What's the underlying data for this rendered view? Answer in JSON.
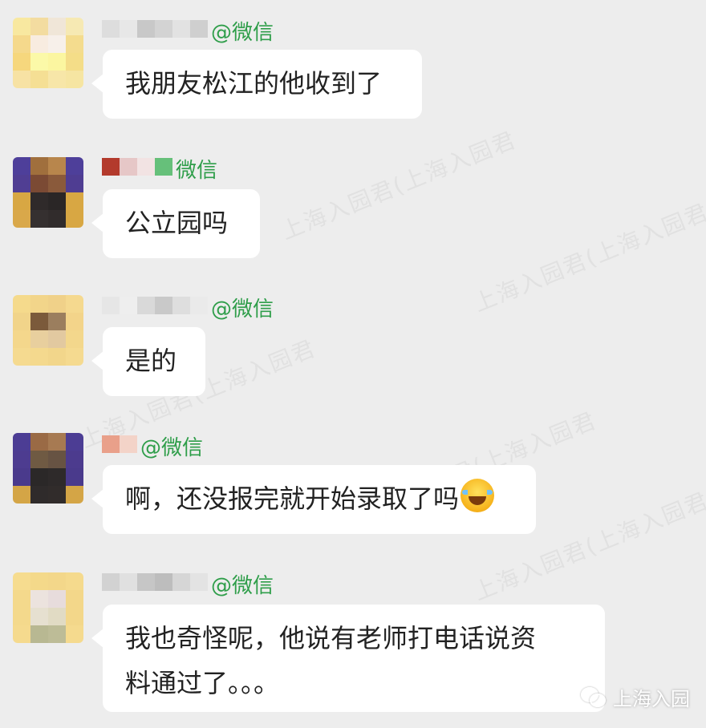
{
  "watermark": {
    "text": "上海入园君(上海入园君"
  },
  "messages": [
    {
      "sender_suffix": "@微信",
      "text": "我朋友松江的他收到了",
      "avatar_colors": [
        "#f8e8a0",
        "#f3dca0",
        "#f0e6d8",
        "#f6e9b3",
        "#f5d98c",
        "#f8ece0",
        "#f7f0ea",
        "#f4dc8e",
        "#f6d77d",
        "#fbf9a8",
        "#fbf6a0",
        "#f4dd88",
        "#f7e2a4",
        "#f5df94",
        "#f7e6a8",
        "#f6e5a2"
      ],
      "name_blocks": [
        "#dddddd",
        "#e7e7e7",
        "#c8c8c8",
        "#d3d3d3",
        "#e2e2e2",
        "#cfcfcf"
      ]
    },
    {
      "sender_suffix": "微信",
      "text": "公立园吗",
      "avatar_colors": [
        "#4e3f9a",
        "#a06f3d",
        "#b8864c",
        "#4e3f9a",
        "#503e93",
        "#7b4a34",
        "#8a5a3b",
        "#4f3d92",
        "#d8a743",
        "#2f2a2a",
        "#2a2626",
        "#d8a743",
        "#d9a84a",
        "#353030",
        "#312c2c",
        "#d8a743"
      ],
      "name_blocks": [
        "#b33a2c",
        "#e6c7c7",
        "#f2e3e3",
        "#66c07a"
      ]
    },
    {
      "sender_suffix": "@微信",
      "text": "是的",
      "avatar_colors": [
        "#f5da8c",
        "#f2d58a",
        "#f0d189",
        "#f5d98f",
        "#f1d48a",
        "#7b5a3b",
        "#9b7e5e",
        "#f3d48a",
        "#f4d78c",
        "#e8cf9e",
        "#e2c9a0",
        "#f3d78c",
        "#f5da90",
        "#f4d98e",
        "#f2d68b",
        "#f5da90"
      ],
      "name_blocks": [
        "#e6e6e6",
        "#eeeeee",
        "#d9d9d9",
        "#c9c9c9",
        "#dedede",
        "#eaeaea"
      ]
    },
    {
      "sender_suffix": "@微信",
      "text": "啊，还没报完就开始录取了吗",
      "has_emoji": true,
      "emoji_name": "laughing-crying-face",
      "avatar_colors": [
        "#4c3d94",
        "#9a6a45",
        "#a77a52",
        "#4c3d94",
        "#4d3c90",
        "#6f5a43",
        "#675343",
        "#4c3b8e",
        "#4a3a8c",
        "#2b2828",
        "#2e2a2a",
        "#4a3a8c",
        "#d4a546",
        "#2f2b2b",
        "#312c2b",
        "#d4a546"
      ],
      "name_blocks": [
        "#e9a08a",
        "#f3d3c8"
      ]
    },
    {
      "sender_suffix": "@微信",
      "text_lines": [
        "我也奇怪呢，他说有老师打电话说资",
        "料通过了。。。"
      ],
      "avatar_colors": [
        "#f6dc8f",
        "#f4d98a",
        "#f3d78a",
        "#f5da8d",
        "#f4d98c",
        "#ece3de",
        "#e7dcdc",
        "#f3d78a",
        "#f4d98c",
        "#e6e0d0",
        "#e1dbc4",
        "#f3d78a",
        "#f5da8e",
        "#b8b892",
        "#bdbc97",
        "#f5da8e"
      ],
      "name_blocks": [
        "#d2d2d2",
        "#e0e0e0",
        "#c6c6c6",
        "#bdbdbd",
        "#d6d6d6",
        "#e3e3e3"
      ]
    }
  ],
  "brand": {
    "label": "上海入园",
    "icon": "wechat-icon"
  }
}
